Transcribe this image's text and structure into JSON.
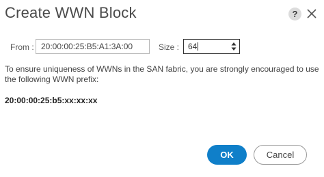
{
  "dialog": {
    "title": "Create WWN Block",
    "help_label": "?",
    "close_icon": "close-icon"
  },
  "form": {
    "from_label": "From :",
    "from_value": "20:00:00:25:B5:A1:3A:00",
    "size_label": "Size :",
    "size_value": "64"
  },
  "info": {
    "message": "To ensure uniqueness of WWNs in the SAN fabric, you are strongly encouraged to use the following WWN prefix:",
    "prefix": "20:00:00:25:b5:xx:xx:xx"
  },
  "buttons": {
    "ok_label": "OK",
    "cancel_label": "Cancel"
  },
  "colors": {
    "primary_button": "#0f7fc9",
    "title_text": "#4a4a4a"
  }
}
